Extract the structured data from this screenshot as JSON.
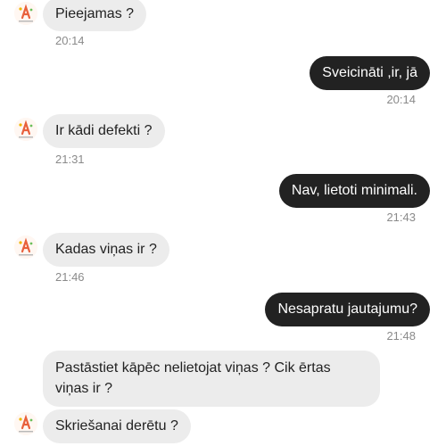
{
  "messages": [
    {
      "text": "Pieejamas ?",
      "time": "20:14"
    },
    {
      "text": "Sveicināti ,ir, jā",
      "time": "20:14"
    },
    {
      "text": "Ir kādi defekti ?",
      "time": "21:31"
    },
    {
      "text": "Nav, lietoti minimali.",
      "time": "21:43"
    },
    {
      "text": "Kadas viņas ir ?",
      "time": "21:46"
    },
    {
      "text": "Nesapratu jautajumu?",
      "time": "21:48"
    },
    {
      "text": "Pastāstiet kāpēc nelietojat viņas ? Cik ērtas viņas ir ?"
    },
    {
      "text": "Skriešanai derētu ?"
    }
  ],
  "colors": {
    "incoming_bubble": "#ececec",
    "outgoing_bubble": "#222222",
    "avatar_accent": "#e8603c"
  }
}
